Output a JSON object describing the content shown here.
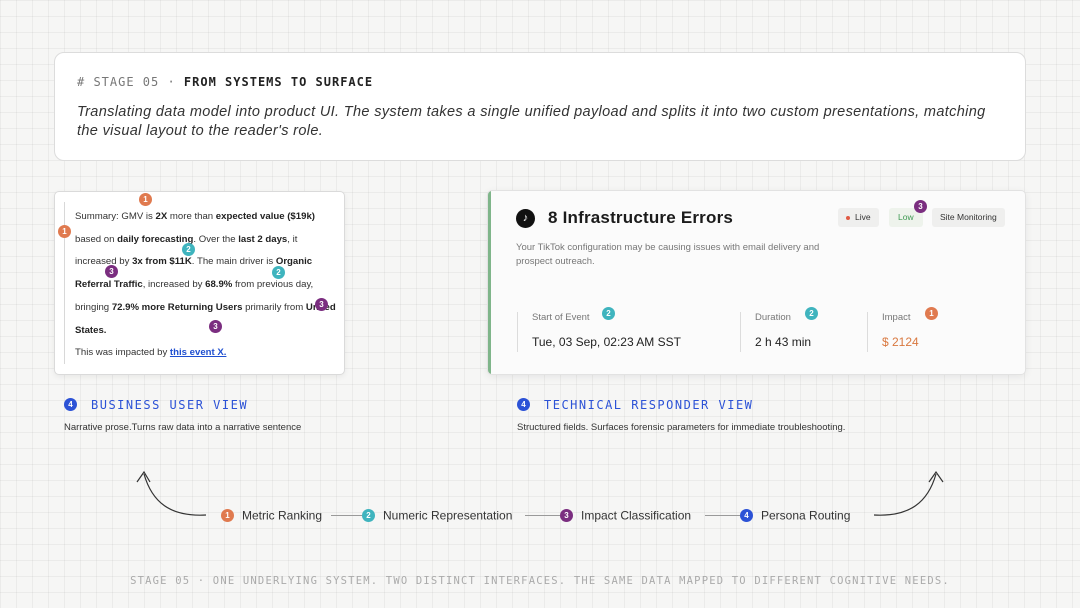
{
  "header": {
    "stage_prefix": "# STAGE 05 · ",
    "stage_title": "FROM SYSTEMS TO SURFACE",
    "description": "Translating data model into product UI. The system takes a single unified payload and splits it into two custom presentations, matching the visual layout to the reader's role."
  },
  "business_card": {
    "segments": [
      {
        "t": "Summary: GMV is ",
        "b": false
      },
      {
        "t": "2X",
        "b": true
      },
      {
        "t": " more than ",
        "b": false
      },
      {
        "t": "expected value ($19k)",
        "b": true
      },
      {
        "t": " based on ",
        "b": false
      },
      {
        "t": "daily forecasting",
        "b": true
      },
      {
        "t": ". Over the ",
        "b": false
      },
      {
        "t": "last 2 days",
        "b": true
      },
      {
        "t": ", it increased by ",
        "b": false
      },
      {
        "t": "3x from $11K",
        "b": true
      },
      {
        "t": ". The main driver is ",
        "b": false
      },
      {
        "t": "Organic Referral Traffic",
        "b": true
      },
      {
        "t": ", increased by ",
        "b": false
      },
      {
        "t": "68.9%",
        "b": true
      },
      {
        "t": " from previous day, bringing ",
        "b": false
      },
      {
        "t": "72.9% more Returning Users",
        "b": true
      },
      {
        "t": " primarily from ",
        "b": false
      },
      {
        "t": "United States.",
        "b": true
      }
    ],
    "impact_prefix": "This was impacted by ",
    "impact_link": "this event X."
  },
  "tech_card": {
    "title": "8 Infrastructure Errors",
    "tags": {
      "live": "Live",
      "low": "Low",
      "site": "Site Monitoring"
    },
    "description": "Your TikTok configuration may be causing issues with email delivery and prospect outreach.",
    "fields": {
      "start_label": "Start of Event",
      "start_value": "Tue, 03 Sep, 02:23 AM SST",
      "duration_label": "Duration",
      "duration_value": "2 h 43 min",
      "impact_label": "Impact",
      "impact_value": "$ 2124"
    }
  },
  "views": {
    "business_title": "BUSINESS USER VIEW",
    "business_sub": "Narrative prose.Turns raw data into a narrative sentence",
    "technical_title": "TECHNICAL RESPONDER VIEW",
    "technical_sub": "Structured fields. Surfaces forensic parameters for immediate troubleshooting."
  },
  "badges": {
    "one": "1",
    "two": "2",
    "three": "3",
    "four": "4"
  },
  "pipeline": [
    "Metric Ranking",
    "Numeric Representation",
    "Impact Classification",
    "Persona Routing"
  ],
  "footer": "STAGE 05 · ONE UNDERLYING SYSTEM. TWO DISTINCT INTERFACES. THE SAME DATA MAPPED TO DIFFERENT COGNITIVE NEEDS.",
  "colors": {
    "metric": "#e07a4f",
    "numeric": "#3fb4be",
    "impact": "#7b2e80",
    "persona": "#2c52d6",
    "live_accent": "#7fb58a"
  },
  "icons": {
    "tech_card": "tiktok-icon",
    "left_arrow": "curved-arrow-up-left-icon",
    "right_arrow": "curved-arrow-up-right-icon"
  }
}
